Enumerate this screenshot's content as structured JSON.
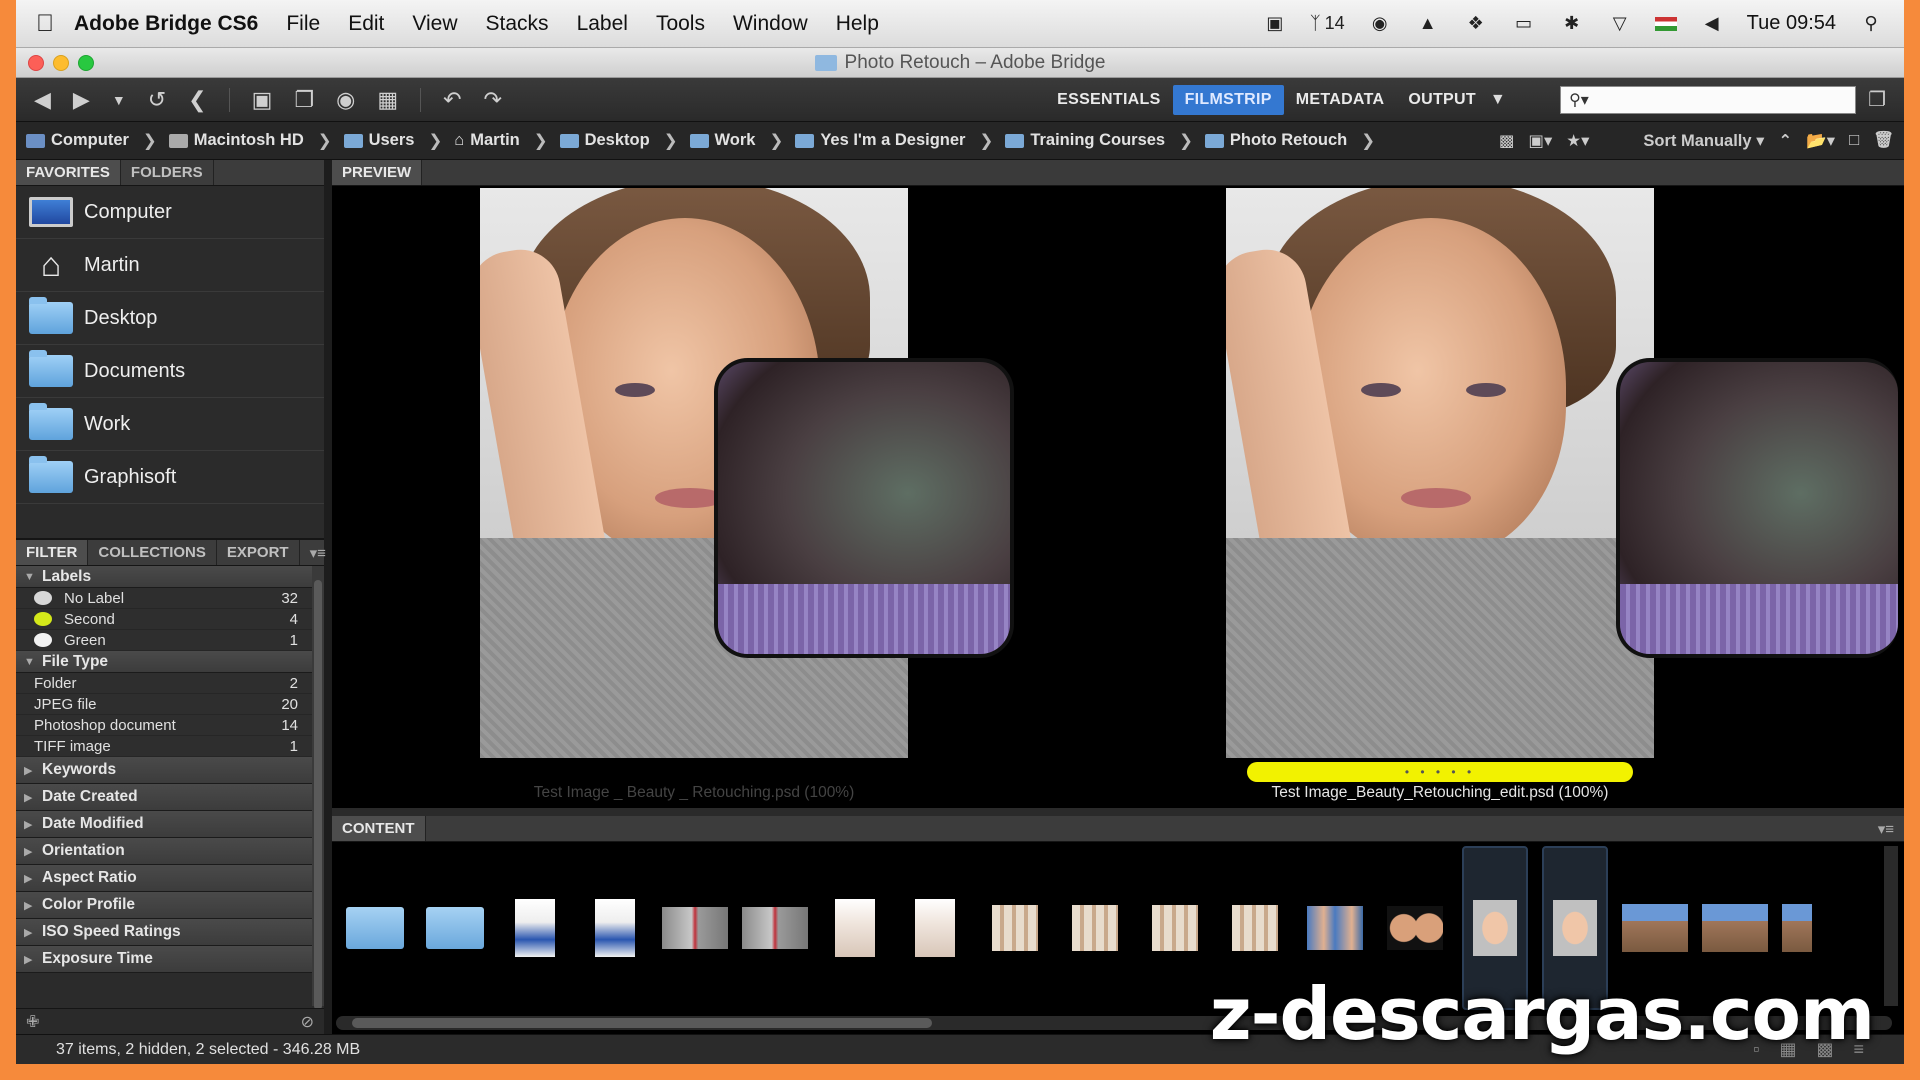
{
  "menubar": {
    "app_name": "Adobe Bridge CS6",
    "items": [
      "File",
      "Edit",
      "View",
      "Stacks",
      "Label",
      "Tools",
      "Window",
      "Help"
    ],
    "adobe_count": "14",
    "clock": "Tue 09:54"
  },
  "window": {
    "title": "Photo Retouch – Adobe Bridge"
  },
  "toolbar": {
    "workspaces": [
      "ESSENTIALS",
      "FILMSTRIP",
      "METADATA",
      "OUTPUT"
    ],
    "active_workspace": "FILMSTRIP",
    "search_placeholder": ""
  },
  "path": {
    "crumbs": [
      "Computer",
      "Macintosh HD",
      "Users",
      "Martin",
      "Desktop",
      "Work",
      "Yes I'm a Designer",
      "Training Courses",
      "Photo Retouch"
    ],
    "sort_label": "Sort Manually"
  },
  "favorites": {
    "tabs": [
      "FAVORITES",
      "FOLDERS"
    ],
    "items": [
      {
        "label": "Computer",
        "icon": "computer-icon"
      },
      {
        "label": "Martin",
        "icon": "home-icon"
      },
      {
        "label": "Desktop",
        "icon": "folder-icon"
      },
      {
        "label": "Documents",
        "icon": "folder-icon"
      },
      {
        "label": "Work",
        "icon": "folder-icon"
      },
      {
        "label": "Graphisoft",
        "icon": "folder-icon"
      }
    ]
  },
  "filter": {
    "tabs": [
      "FILTER",
      "COLLECTIONS",
      "EXPORT"
    ],
    "labels_head": "Labels",
    "labels": [
      {
        "label": "No Label",
        "count": "32",
        "color": "#d8d8d8"
      },
      {
        "label": "Second",
        "count": "4",
        "color": "#d4e81a"
      },
      {
        "label": "Green",
        "count": "1",
        "color": "#f2f2f2"
      }
    ],
    "filetype_head": "File Type",
    "filetypes": [
      {
        "label": "Folder",
        "count": "2"
      },
      {
        "label": "JPEG file",
        "count": "20"
      },
      {
        "label": "Photoshop document",
        "count": "14"
      },
      {
        "label": "TIFF image",
        "count": "1"
      }
    ],
    "collapsed": [
      "Keywords",
      "Date Created",
      "Date Modified",
      "Orientation",
      "Aspect Ratio",
      "Color Profile",
      "ISO Speed Ratings",
      "Exposure Time"
    ]
  },
  "preview": {
    "tab": "PREVIEW",
    "left_caption": "Test Image _ Beauty _ Retouching.psd (100%)",
    "right_caption": "Test Image_Beauty_Retouching_edit.psd (100%)",
    "label_color": "#f2f200"
  },
  "content": {
    "tab": "CONTENT"
  },
  "status": {
    "text": "37 items, 2 hidden, 2 selected - 346.28 MB"
  },
  "watermark": "z-descargas.com"
}
